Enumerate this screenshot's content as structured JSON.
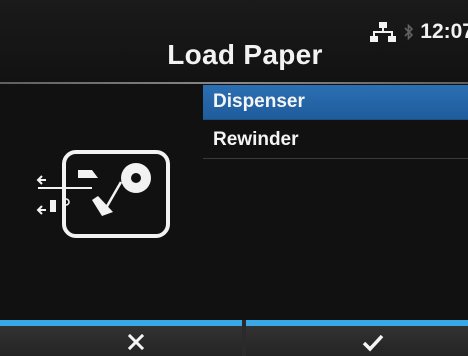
{
  "header": {
    "title": "Load Paper",
    "time": "12:07",
    "network_icon": "network-icon",
    "bluetooth_icon": "bluetooth-icon"
  },
  "menu": {
    "items": [
      {
        "label": "Dispenser",
        "selected": true
      },
      {
        "label": "Rewinder",
        "selected": false
      }
    ]
  },
  "illustration": {
    "icon": "printer-paper-path-icon"
  },
  "buttons": {
    "cancel": {
      "icon": "cross-icon"
    },
    "confirm": {
      "icon": "checkmark-icon"
    }
  },
  "colors": {
    "selected_item": "#2467a8",
    "button_accent": "#38a9e6",
    "background": "#111111"
  }
}
